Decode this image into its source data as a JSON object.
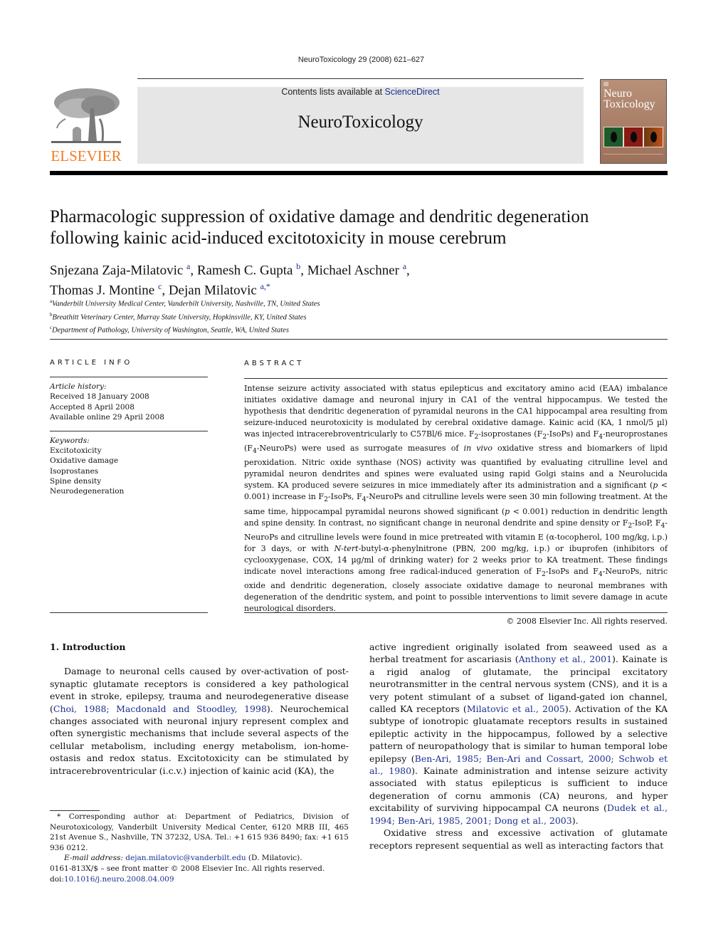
{
  "header": {
    "journal_ref": "NeuroToxicology 29 (2008) 621–627",
    "contents_prefix": "Contents lists available at ",
    "contents_link": "ScienceDirect",
    "journal_title": "NeuroToxicology",
    "publisher_logo": "ELSEVIER",
    "cover_title_line1": "Neuro",
    "cover_title_line2": "Toxicology"
  },
  "colors": {
    "link": "#1b2f8f",
    "elsevier_orange": "#f47b20",
    "banner_bg": "#e6e6e6",
    "cover_bg": "#a87c64"
  },
  "article": {
    "title_line1": "Pharmacologic suppression of oxidative damage and dendritic degeneration",
    "title_line2": "following kainic acid-induced excitotoxicity in mouse cerebrum",
    "authors": [
      {
        "name": "Snjezana Zaja-Milatovic",
        "sup": "a",
        "sep": ", "
      },
      {
        "name": "Ramesh C. Gupta",
        "sup": "b",
        "sep": ", "
      },
      {
        "name": "Michael Aschner",
        "sup": "a",
        "sep": ","
      },
      {
        "name": "Thomas J. Montine",
        "sup": "c",
        "sep": ", "
      },
      {
        "name": "Dejan Milatovic",
        "sup": "a,*",
        "sep": ""
      }
    ],
    "affiliations": [
      {
        "mark": "a",
        "text": "Vanderbilt University Medical Center, Vanderbilt University, Nashville, TN, United States"
      },
      {
        "mark": "b",
        "text": "Breathitt Veterinary Center, Murray State University, Hopkinsville, KY, United States"
      },
      {
        "mark": "c",
        "text": "Department of Pathology, University of Washington, Seattle, WA, United States"
      }
    ]
  },
  "article_info": {
    "label": "ARTICLE INFO",
    "history_label": "Article history:",
    "history": [
      "Received 18 January 2008",
      "Accepted 8 April 2008",
      "Available online 29 April 2008"
    ],
    "keywords_label": "Keywords:",
    "keywords": [
      "Excitotoxicity",
      "Oxidative damage",
      "Isoprostanes",
      "Spine density",
      "Neurodegeneration"
    ]
  },
  "abstract": {
    "label": "ABSTRACT",
    "p1": "Intense seizure activity associated with status epilepticus and excitatory amino acid (EAA) imbalance initiates oxidative damage and neuronal injury in CA1 of the ventral hippocampus. We tested the hypothesis that dendritic degeneration of pyramidal neurons in the CA1 hippocampal area resulting from seizure-induced neurotoxicity is modulated by cerebral oxidative damage. Kainic acid (KA, 1 nmol/5 µl) was injected intracerebroventricularly to C57Bl/6 mice. ",
    "f2": "F",
    "s2": "2",
    "f4": "F",
    "s4": "4",
    "p2a": "-isoprostanes (",
    "p2b": "-IsoPs) and ",
    "p2c": "-neuroprostanes (",
    "p2d": "-NeuroPs) were used as surrogate measures of ",
    "in_vivo": "in vivo",
    "p3": " oxidative stress and biomarkers of lipid peroxidation. Nitric oxide synthase (NOS) activity was quantified by evaluating citrulline level and pyramidal neuron dendrites and spines were evaluated using rapid Golgi stains and a Neurolucida system. KA produced severe seizures in mice immediately after its administration and a significant (",
    "p_symbol": "p",
    "p4": " < 0.001) increase in ",
    "p5": "-IsoPs, ",
    "p6": "-NeuroPs and citrulline levels were seen 30 min following treatment. At the same time, hippocampal pyramidal neurons showed significant (",
    "p7": " < 0.001) reduction in dendritic length and spine density. In contrast, no significant change in neuronal dendrite and spine density or ",
    "p8": "-IsoP, ",
    "p9": "-NeuroPs and citrulline levels were found in mice pretreated with vitamin E (α-tocopherol, 100 mg/kg, i.p.) for 3 days, or with ",
    "ntert_a": "N",
    "ntert_b": "-",
    "ntert_c": "tert",
    "p10": "-butyl-α-phenylnitrone (PBN, 200 mg/kg, i.p.) or ibuprofen (inhibitors of cyclooxygenase, COX, 14 µg/ml of drinking water) for 2 weeks prior to KA treatment. These findings indicate novel interactions among free radical-induced generation of ",
    "p11": "-IsoPs and ",
    "p12": "-NeuroPs, nitric oxide and dendritic degeneration, closely associate oxidative damage to neuronal membranes with degeneration of the dendritic system, and point to possible interventions to limit severe damage in acute neurological disorders.",
    "copyright": "© 2008 Elsevier Inc. All rights reserved."
  },
  "body": {
    "section_heading": "1. Introduction",
    "left_p1_a": "Damage to neuronal cells caused by over-activation of post-synaptic glutamate receptors is considered a key pathological event in stroke, epilepsy, trauma and neurodegenerative disease (",
    "left_p1_cite": "Choi, 1988; Macdonald and Stoodley, 1998",
    "left_p1_b": "). Neurochemical changes associated with neuronal injury represent complex and often synergistic mechanisms that include several aspects of the cellular metabolism, including energy metabolism, ion-home-ostasis and redox status. Excitotoxicity can be stimulated by intracerebroventricular (i.c.v.) injection of kainic acid (KA), the",
    "right_p1_a": "active ingredient originally isolated from seaweed used as a herbal treatment for ascariasis (",
    "right_cite1": "Anthony et al., 2001",
    "right_p1_b": "). Kainate is a rigid analog of glutamate, the principal excitatory neurotransmitter in the central nervous system (CNS), and it is a very potent stimulant of a subset of ligand-gated ion channel, called KA receptors (",
    "right_cite2": "Milatovic et al., 2005",
    "right_p1_c": "). Activation of the KA subtype of ionotropic gluatamate receptors results in sustained epileptic activity in the hippocampus, followed by a selective pattern of neuropathology that is similar to human temporal lobe epilepsy (",
    "right_cite3": "Ben-Ari, 1985; Ben-Ari and Cossart, 2000; Schwob et al., 1980",
    "right_p1_d": "). Kainate administration and intense seizure activity associated with status epilepticus is sufficient to induce degeneration of cornu ammonis (CA) neurons, and hyper excitability of surviving hippocampal CA neurons (",
    "right_cite4": "Dudek et al., 1994; Ben-Ari, 1985, 2001; Dong et al., 2003",
    "right_p1_e": ").",
    "right_p2": "Oxidative stress and excessive activation of glutamate receptors represent sequential as well as interacting factors that"
  },
  "footnotes": {
    "corresponding": "* Corresponding author at: Department of Pediatrics, Division of Neurotoxicology, Vanderbilt University Medical Center, 6120 MRB III, 465 21st Avenue S., Nashville, TN 37232, USA. Tel.: +1 615 936 8490; fax: +1 615 936 0212.",
    "email_label": "E-mail address:",
    "email": "dejan.milatovic@vanderbilt.edu",
    "email_suffix": " (D. Milatovic).",
    "issn": "0161-813X/$ – see front matter © 2008 Elsevier Inc. All rights reserved.",
    "doi_prefix": "doi:",
    "doi": "10.1016/j.neuro.2008.04.009"
  }
}
